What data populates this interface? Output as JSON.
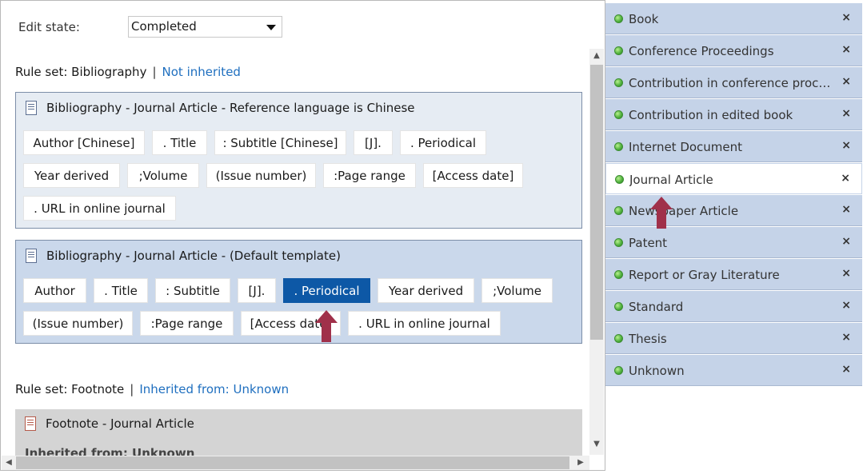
{
  "edit_state": {
    "label": "Edit state:",
    "value": "Completed"
  },
  "ruleset_bib": {
    "label": "Rule set: Bibliography",
    "separator": "|",
    "link": "Not inherited"
  },
  "box1": {
    "title": "Bibliography - Journal Article - Reference language is Chinese",
    "tokens": [
      "Author [Chinese]",
      ". Title",
      ": Subtitle [Chinese]",
      "[J].",
      ". Periodical",
      "Year derived",
      ";Volume",
      "(Issue number)",
      ":Page range",
      "[Access date]",
      ". URL in online journal"
    ]
  },
  "box2": {
    "title": "Bibliography - Journal Article - (Default template)",
    "tokens": [
      "Author",
      ". Title",
      ": Subtitle",
      "[J].",
      ". Periodical",
      "Year derived",
      ";Volume",
      "(Issue number)",
      ":Page range",
      "[Access date]",
      ". URL in online journal"
    ],
    "active_token": ". Periodical"
  },
  "ruleset_foot": {
    "label": "Rule set: Footnote",
    "separator": "|",
    "link": "Inherited from: Unknown"
  },
  "footnote": {
    "title": "Footnote - Journal Article",
    "sub": "Inherited from: Unknown"
  },
  "right_panel": {
    "items": [
      "Book",
      "Conference Proceedings",
      "Contribution in conference proc…",
      "Contribution in edited book",
      "Internet Document",
      "Journal Article",
      "Newspaper Article",
      "Patent",
      "Report or Gray Literature",
      "Standard",
      "Thesis",
      "Unknown"
    ],
    "selected": "Journal Article",
    "close_glyph": "×"
  },
  "colors": {
    "accent": "#0d58a6",
    "link": "#1f6fbf",
    "panel": "#c5d3e8",
    "arrow": "#a0304a"
  },
  "icons": [
    "dropdown-caret-icon",
    "document-icon",
    "status-dot-icon",
    "close-icon",
    "red-arrow-annotation"
  ]
}
